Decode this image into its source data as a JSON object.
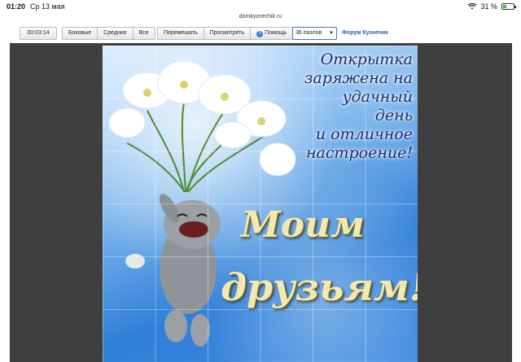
{
  "status": {
    "time": "01:20",
    "date": "Ср 13 мая",
    "battery": "31 %",
    "battery_level": 0.31
  },
  "browser": {
    "url": "domkyznechik.ru"
  },
  "toolbar": {
    "timer": "00:03:14",
    "view_buttons": [
      "Боковые",
      "Средние",
      "Все"
    ],
    "shuffle": "Перемешать",
    "preview": "Просмотреть",
    "help": "Помощь",
    "pieces_select": "36 пазлов",
    "forum_link": "Форум Кузнечик"
  },
  "card": {
    "lines": [
      "Открытка",
      "заряжена на",
      "удачный",
      "день",
      "и отличное",
      "настроение!"
    ],
    "big_line1": "Моим",
    "big_line2": "друзьям!"
  },
  "colors": {
    "accent": "#2a5db0",
    "sky": "#3d8be0"
  }
}
